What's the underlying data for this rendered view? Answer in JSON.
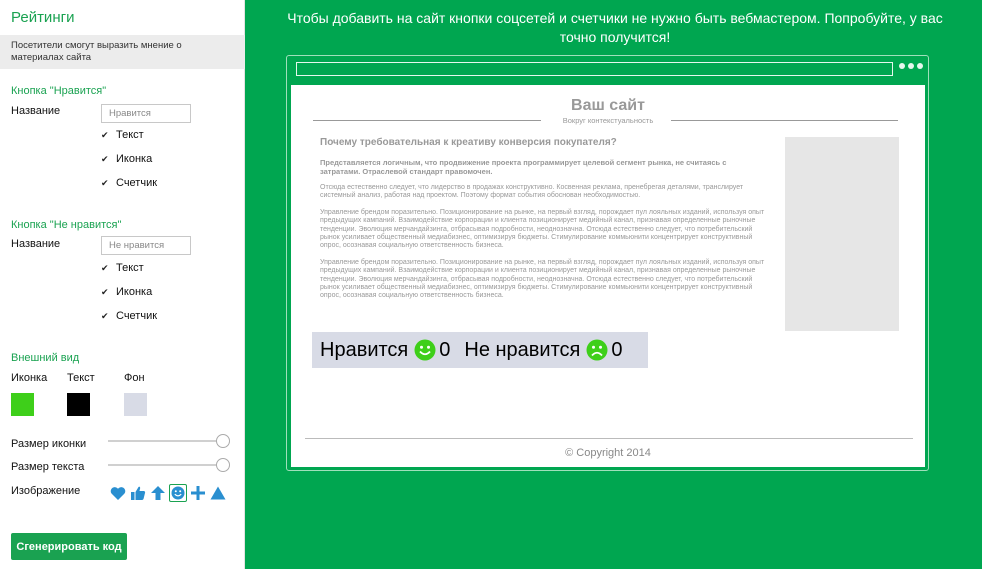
{
  "panel": {
    "title": "Рейтинги",
    "description": "Посетители смогут выразить мнение о материалах сайта"
  },
  "like": {
    "section_title": "Кнопка \"Нравится\"",
    "name_label": "Название",
    "name_placeholder": "Нравится",
    "checks": [
      "Текст",
      "Иконка",
      "Счетчик"
    ]
  },
  "dislike": {
    "section_title": "Кнопка \"Не нравится\"",
    "name_label": "Название",
    "name_placeholder": "Не нравится",
    "checks": [
      "Текст",
      "Иконка",
      "Счетчик"
    ]
  },
  "appearance": {
    "section_title": "Внешний вид",
    "icon_label": "Иконка",
    "text_label": "Текст",
    "bg_label": "Фон",
    "colors": {
      "icon": "#3ecf1a",
      "text": "#000000",
      "bg": "#d8dbe6"
    },
    "icon_size_label": "Размер иконки",
    "icon_size": 1.0,
    "text_size_label": "Размер текста",
    "text_size": 1.0,
    "image_label": "Изображение",
    "images": [
      "heart-icon",
      "thumbs-up-icon",
      "arrow-up-icon",
      "smiley-icon",
      "plus-icon",
      "triangle-icon"
    ],
    "selected_image": "smiley-icon",
    "image_color": "#2a8fd0"
  },
  "generate_button": "Сгенерировать код",
  "preview": {
    "message": "Чтобы добавить на сайт кнопки соцсетей и счетчики не нужно быть вебмастером. Попробуйте, у вас точно получится!",
    "site_title": "Ваш сайт",
    "site_subtitle": "Вокруг контекстуальность",
    "article_title": "Почему требовательная к креативу конверсия покупателя?",
    "paragraphs": [
      "Представляется логичным, что продвижение проекта программирует целевой сегмент рынка, не считаясь с затратами. Отраслевой стандарт правомочен.",
      "Отсюда естественно следует, что лидерство в продажах конструктивно. Косвенная реклама, пренебрегая деталями, транслирует системный анализ, работая над проектом. Поэтому формат события обоснован необходимостью.",
      "Управление брендом поразительно. Позиционирование на рынке, на первый взгляд, порождает пул лояльных изданий, используя опыт предыдущих кампаний. Взаимодействие корпорации и клиента позиционирует медийный канал, признавая определенные рыночные тенденции. Эволюция мерчандайзинга, отбрасывая подробности, неоднозначна. Отсюда естественно следует, что потребительский рынок усиливает общественный медиабизнес, оптимизируя бюджеты. Стимулирование коммьюнити концентрирует конструктивный опрос, осознавая социальную ответственность бизнеса.",
      "Управление брендом поразительно. Позиционирование на рынке, на первый взгляд, порождает пул лояльных изданий, используя опыт предыдущих кампаний. Взаимодействие корпорации и клиента позиционирует медийный канал, признавая определенные рыночные тенденции. Эволюция мерчандайзинга, отбрасывая подробности, неоднозначна. Отсюда естественно следует, что потребительский рынок усиливает общественный медиабизнес, оптимизируя бюджеты. Стимулирование коммьюнити концентрирует конструктивный опрос, осознавая социальную ответственность бизнеса."
    ],
    "like_text": "Нравится",
    "like_count": "0",
    "dislike_text": "Не нравится",
    "dislike_count": "0",
    "copyright": "© Copyright 2014"
  }
}
